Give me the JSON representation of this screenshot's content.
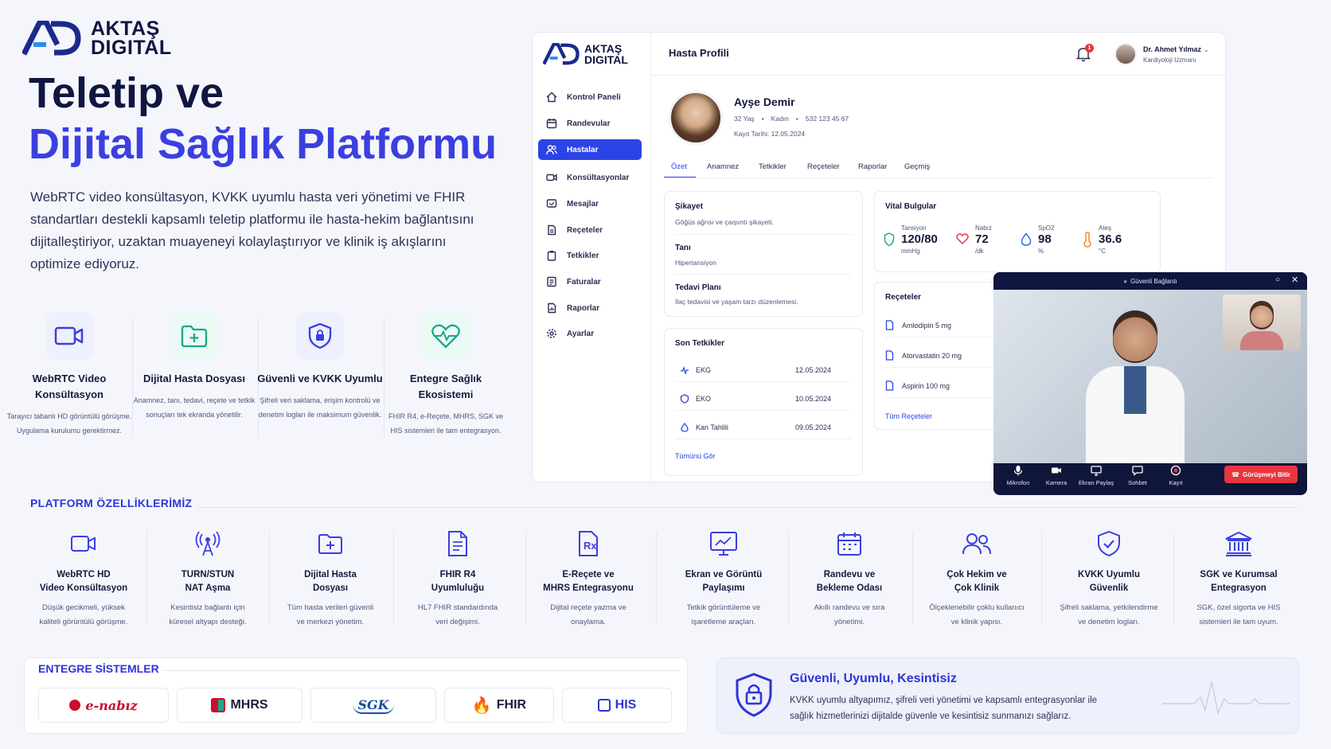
{
  "brand": {
    "line1": "AKTAŞ",
    "line2": "DIGITAL"
  },
  "hero": {
    "title_line1": "Teletip ve",
    "title_line2": "Dijital Sağlık Platformu",
    "description": "WebRTC video konsültasyon, KVKK uyumlu hasta veri yönetimi ve FHIR standartları destekli kapsamlı teletip platformu ile hasta-hekim bağlantısını dijitalleştiriyor, uzaktan muayeneyi kolaylaştırıyor ve klinik iş akışlarını optimize ediyoruz."
  },
  "hero_features": [
    {
      "icon": "video-camera-icon",
      "title": "WebRTC Video Konsültasyon",
      "desc": "Tarayıcı tabanlı HD görüntülü görüşme. Uygulama kurulumu gerektirmez."
    },
    {
      "icon": "folder-plus-icon",
      "title": "Dijital Hasta Dosyası",
      "desc": "Anamnez, tanı, tedavi, reçete ve tetkik sonuçları tek ekranda yönetilir."
    },
    {
      "icon": "shield-lock-icon",
      "title": "Güvenli ve KVKK Uyumlu",
      "desc": "Şifreli veri saklama, erişim kontrolü ve denetim logları ile maksimum güvenlik."
    },
    {
      "icon": "heart-pulse-icon",
      "title": "Entegre Sağlık Ekosistemi",
      "desc": "FHIR R4, e-Reçete, MHRS, SGK ve HIS sistemleri ile tam entegrasyon."
    }
  ],
  "platform": {
    "section_title": "PLATFORM ÖZELLİKLERİMİZ",
    "features": [
      {
        "icon": "video-camera-icon",
        "title1": "WebRTC HD",
        "title2": "Video Konsültasyon",
        "desc1": "Düşük gecikmeli, yüksek",
        "desc2": "kaliteli görüntülü görüşme."
      },
      {
        "icon": "antenna-icon",
        "title1": "TURN/STUN",
        "title2": "NAT Aşma",
        "desc1": "Kesintisiz bağlantı için",
        "desc2": "küresel altyapı desteği."
      },
      {
        "icon": "folder-plus-icon",
        "title1": "Dijital Hasta",
        "title2": "Dosyası",
        "desc1": "Tüm hasta verileri güvenli",
        "desc2": "ve merkezi yönetim."
      },
      {
        "icon": "document-icon",
        "title1": "FHIR R4",
        "title2": "Uyumluluğu",
        "desc1": "HL7 FHIR standardında",
        "desc2": "veri değişimi."
      },
      {
        "icon": "prescription-icon",
        "title1": "E-Reçete ve",
        "title2": "MHRS Entegrasyonu",
        "desc1": "Dijital reçete yazma ve",
        "desc2": "onaylama."
      },
      {
        "icon": "monitor-chart-icon",
        "title1": "Ekran ve Görüntü",
        "title2": "Paylaşımı",
        "desc1": "Tetkik görüntüleme ve",
        "desc2": "işaretleme araçları."
      },
      {
        "icon": "calendar-icon",
        "title1": "Randevu ve",
        "title2": "Bekleme Odası",
        "desc1": "Akıllı randevu ve sıra",
        "desc2": "yönetimi."
      },
      {
        "icon": "users-icon",
        "title1": "Çok Hekim ve",
        "title2": "Çok Klinik",
        "desc1": "Ölçeklenebilir çoklu kullanıcı",
        "desc2": "ve klinik yapısı."
      },
      {
        "icon": "shield-check-icon",
        "title1": "KVKK Uyumlu",
        "title2": "Güvenlik",
        "desc1": "Şifreli saklama, yetkilendirme",
        "desc2": "ve denetim logları."
      },
      {
        "icon": "bank-icon",
        "title1": "SGK ve Kurumsal",
        "title2": "Entegrasyon",
        "desc1": "SGK, özel sigorta ve HIS",
        "desc2": "sistemleri ile tam uyum."
      }
    ]
  },
  "integrations": {
    "title": "ENTEGRE SİSTEMLER",
    "items": [
      "e-nabız",
      "MHRS",
      "SGK",
      "FHIR",
      "HIS"
    ]
  },
  "secure_banner": {
    "title": "Güvenli, Uyumlu, Kesintisiz",
    "text1": "KVKK uyumlu altyapımız, şifreli veri yönetimi ve kapsamlı entegrasyonlar ile",
    "text2": "sağlık hizmetlerinizi dijitalde güvenle ve kesintisiz sunmanızı sağlarız."
  },
  "dashboard": {
    "header_title": "Hasta Profili",
    "notification_count": "1",
    "doctor": {
      "name": "Dr. Ahmet Yılmaz",
      "role": "Kardiyoloji Uzmanı"
    },
    "nav": [
      {
        "label": "Kontrol Paneli",
        "icon": "home-icon"
      },
      {
        "label": "Randevular",
        "icon": "calendar-icon"
      },
      {
        "label": "Hastalar",
        "icon": "users-icon",
        "active": true
      },
      {
        "label": "Konsültasyonlar",
        "icon": "video-icon"
      },
      {
        "label": "Mesajlar",
        "icon": "message-icon"
      },
      {
        "label": "Reçeteler",
        "icon": "file-icon"
      },
      {
        "label": "Tetkikler",
        "icon": "clipboard-icon"
      },
      {
        "label": "Faturalar",
        "icon": "invoice-icon"
      },
      {
        "label": "Raporlar",
        "icon": "report-icon"
      },
      {
        "label": "Ayarlar",
        "icon": "gear-icon"
      }
    ],
    "patient": {
      "name": "Ayşe Demir",
      "age": "32 Yaş",
      "gender": "Kadın",
      "phone": "532 123 45 67",
      "registered": "Kayıt Tarihi: 12.05.2024"
    },
    "tabs": [
      "Özet",
      "Anamnez",
      "Tetkikler",
      "Reçeteler",
      "Raporlar",
      "Geçmiş"
    ],
    "summary": {
      "complaint_label": "Şikayet",
      "complaint": "Göğüs ağrısı ve çarpıntı şikayeti.",
      "diagnosis_label": "Tanı",
      "diagnosis": "Hipertansiyon",
      "plan_label": "Tedavi Planı",
      "plan": "İlaç tedavisi ve yaşam tarzı düzenlemesi."
    },
    "tests": {
      "title": "Son Tetkikler",
      "rows": [
        {
          "name": "EKG",
          "date": "12.05.2024"
        },
        {
          "name": "EKO",
          "date": "10.05.2024"
        },
        {
          "name": "Kan Tahlili",
          "date": "09.05.2024"
        }
      ],
      "link": "Tümünü Gör"
    },
    "vitals": {
      "title": "Vital Bulgular",
      "items": [
        {
          "name": "Tansiyon",
          "value": "120/80",
          "unit": "mmHg",
          "color": "#2aa876"
        },
        {
          "name": "Nabız",
          "value": "72",
          "unit": "/dk",
          "color": "#e23a4e"
        },
        {
          "name": "SpO2",
          "value": "98",
          "unit": "%",
          "color": "#2b6fe6"
        },
        {
          "name": "Ateş",
          "value": "36.6",
          "unit": "°C",
          "color": "#f08a24"
        }
      ]
    },
    "prescriptions": {
      "title": "Reçeteler",
      "items": [
        "Amlodipin 5 mg",
        "Atorvastatin 20 mg",
        "Aspirin 100 mg"
      ],
      "link": "Tüm Reçeteler"
    }
  },
  "video_call": {
    "status": "Güvenli Bağlantı",
    "controls": [
      "Mikrofon",
      "Kamera",
      "Ekran Paylaş",
      "Sohbet",
      "Kayıt"
    ],
    "end_label": "Görüşmeyi Bitir"
  },
  "colors": {
    "brand": "#2d35d6",
    "accent": "#3b3fe0",
    "dark": "#0f1640",
    "teal": "#1fa68a",
    "end_call": "#e8353f"
  }
}
